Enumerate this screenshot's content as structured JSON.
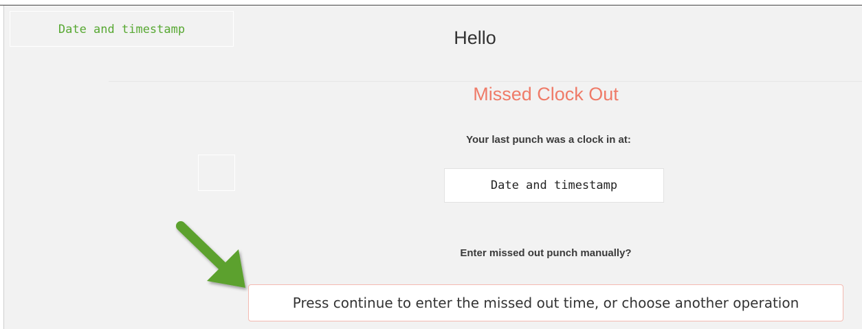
{
  "header": {
    "date_timestamp": "Date and timestamp",
    "greeting": "Hello"
  },
  "main": {
    "title": "Missed Clock Out",
    "last_punch_label": "Your last punch was a clock in at:",
    "last_punch_value": "Date and timestamp",
    "question": "Enter missed out punch manually?",
    "continue_message": "Press continue to enter the missed out time, or choose another operation"
  },
  "colors": {
    "accent_green": "#57a832",
    "title_salmon": "#ef7b68",
    "arrow_green": "#5ba12e"
  },
  "icons": {
    "annotation": "arrow-pointer-icon"
  }
}
